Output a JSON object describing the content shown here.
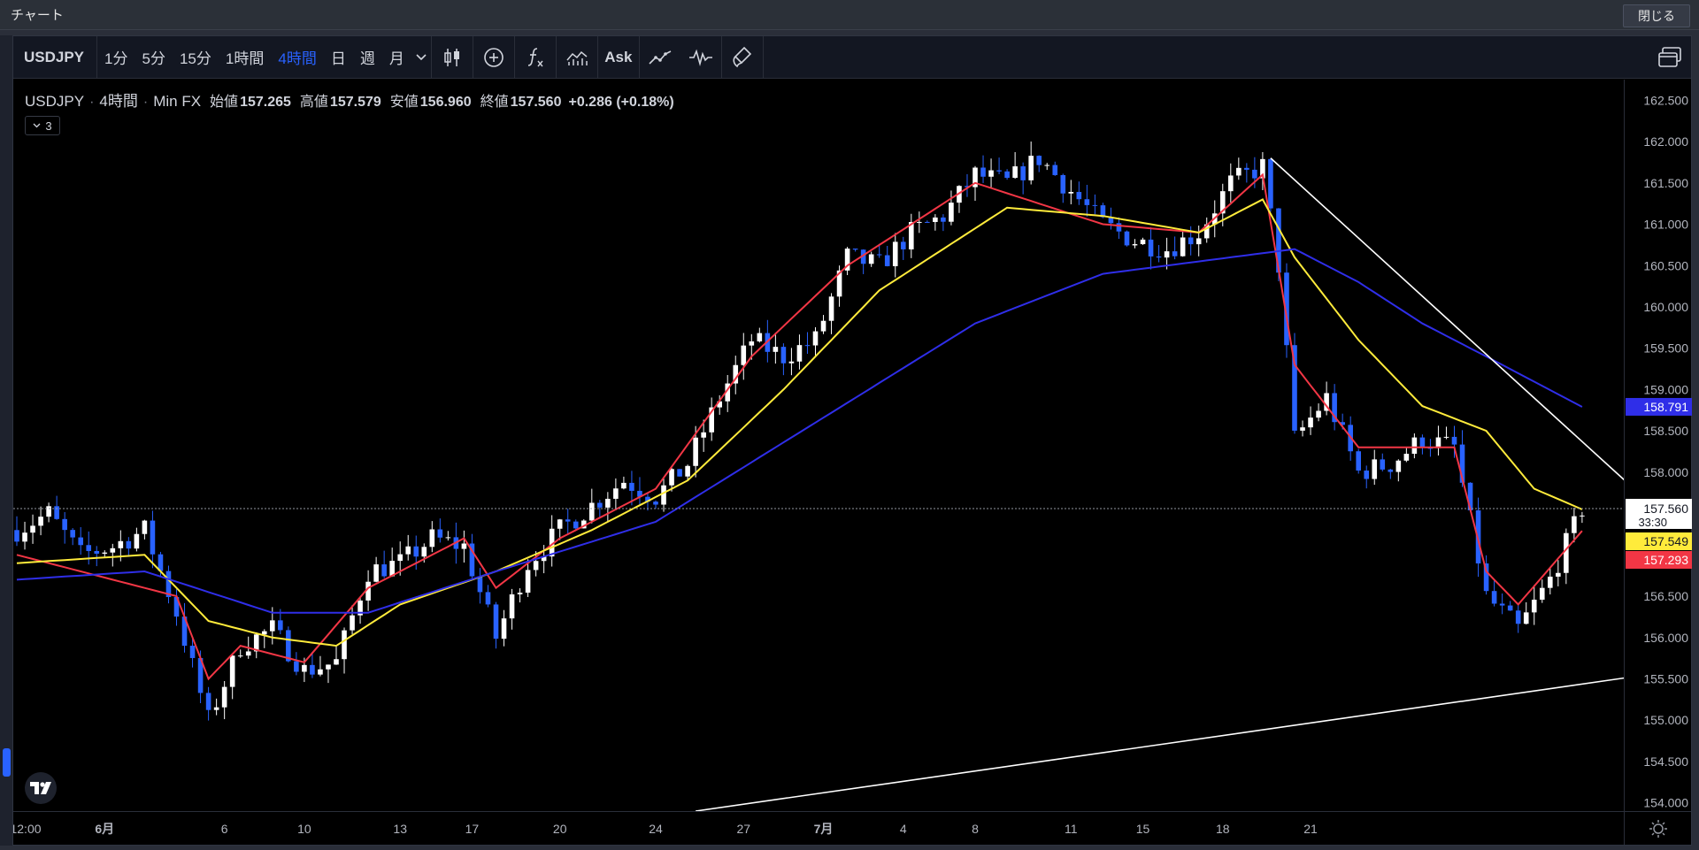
{
  "window": {
    "title": "チャート",
    "close_label": "閉じる"
  },
  "toolbar": {
    "symbol": "USDJPY",
    "intervals": [
      "1分",
      "5分",
      "15分",
      "1時間",
      "4時間",
      "日",
      "週",
      "月"
    ],
    "active_interval": "4時間",
    "ask_label": "Ask",
    "icons": [
      "chevron-down-icon",
      "candlestick-icon",
      "add-indicator-icon",
      "function-icon",
      "bar-compare-icon",
      "line-chart-icon",
      "waveform-icon",
      "brush-icon",
      "layout-icon"
    ]
  },
  "legend": {
    "symbol": "USDJPY",
    "interval": "4時間",
    "source": "Min FX",
    "open_label": "始値",
    "open": "157.265",
    "high_label": "高値",
    "high": "157.579",
    "low_label": "安値",
    "low": "156.960",
    "close_label": "終値",
    "close": "157.560",
    "change": "+0.286 (+0.18%)",
    "indicator_count": "3"
  },
  "price_axis": {
    "ticks": [
      "162.500",
      "162.000",
      "161.500",
      "161.000",
      "160.500",
      "160.000",
      "159.500",
      "159.000",
      "158.500",
      "158.000",
      "157.500",
      "157.000",
      "156.500",
      "156.000",
      "155.500",
      "155.000",
      "154.500",
      "154.000"
    ],
    "current_price": "157.560",
    "countdown": "33:30",
    "ma_labels": [
      {
        "value": "158.791",
        "color": "#2f2ee8"
      },
      {
        "value": "157.549",
        "color": "#ffeb3b"
      },
      {
        "value": "157.293",
        "color": "#f23645"
      }
    ]
  },
  "time_axis": {
    "labels": [
      "12:00",
      "6月",
      "6",
      "10",
      "13",
      "17",
      "20",
      "24",
      "27",
      "7月",
      "4",
      "8",
      "11",
      "15",
      "18",
      "21"
    ]
  },
  "colors": {
    "up": "#ffffff",
    "down": "#2962ff",
    "ma_fast": "#f23645",
    "ma_mid": "#ffeb3b",
    "ma_slow": "#2f2ee8",
    "trendline": "#ffffff"
  },
  "chart_data": {
    "type": "candlestick",
    "symbol": "USDJPY",
    "timeframe": "4時間",
    "ylim": [
      153.9,
      162.75
    ],
    "x_labels": [
      "12:00",
      "6月",
      "6",
      "10",
      "13",
      "17",
      "20",
      "24",
      "27",
      "7月",
      "4",
      "8",
      "11",
      "15",
      "18",
      "21"
    ],
    "close_path": [
      [
        0,
        157.3
      ],
      [
        4,
        157.5
      ],
      [
        8,
        157.0
      ],
      [
        12,
        157.1
      ],
      [
        16,
        157.3
      ],
      [
        20,
        156.3
      ],
      [
        24,
        155.0
      ],
      [
        28,
        155.9
      ],
      [
        32,
        156.1
      ],
      [
        36,
        155.6
      ],
      [
        40,
        155.7
      ],
      [
        44,
        156.8
      ],
      [
        48,
        156.9
      ],
      [
        52,
        157.2
      ],
      [
        56,
        157.1
      ],
      [
        60,
        156.0
      ],
      [
        64,
        156.9
      ],
      [
        68,
        157.3
      ],
      [
        72,
        157.6
      ],
      [
        76,
        157.9
      ],
      [
        80,
        157.7
      ],
      [
        84,
        158.1
      ],
      [
        88,
        158.9
      ],
      [
        92,
        159.6
      ],
      [
        96,
        159.4
      ],
      [
        100,
        159.6
      ],
      [
        104,
        160.6
      ],
      [
        108,
        160.5
      ],
      [
        112,
        160.9
      ],
      [
        116,
        161.1
      ],
      [
        120,
        161.6
      ],
      [
        124,
        161.5
      ],
      [
        128,
        161.8
      ],
      [
        132,
        161.4
      ],
      [
        136,
        161.0
      ],
      [
        140,
        160.8
      ],
      [
        144,
        160.7
      ],
      [
        148,
        160.9
      ],
      [
        152,
        161.5
      ],
      [
        156,
        161.7
      ],
      [
        158,
        160.5
      ],
      [
        160,
        158.4
      ],
      [
        164,
        158.9
      ],
      [
        168,
        158.0
      ],
      [
        172,
        158.1
      ],
      [
        176,
        158.4
      ],
      [
        180,
        158.3
      ],
      [
        184,
        156.5
      ],
      [
        188,
        156.1
      ],
      [
        192,
        156.7
      ],
      [
        196,
        157.56
      ]
    ],
    "series": [
      {
        "name": "",
        "color": "#f23645",
        "path": [
          [
            0,
            157.0
          ],
          [
            20,
            156.5
          ],
          [
            24,
            155.5
          ],
          [
            28,
            155.9
          ],
          [
            36,
            155.7
          ],
          [
            44,
            156.6
          ],
          [
            56,
            157.2
          ],
          [
            60,
            156.6
          ],
          [
            68,
            157.2
          ],
          [
            80,
            157.8
          ],
          [
            92,
            159.4
          ],
          [
            104,
            160.5
          ],
          [
            120,
            161.5
          ],
          [
            136,
            161.0
          ],
          [
            148,
            160.9
          ],
          [
            156,
            161.6
          ],
          [
            160,
            159.3
          ],
          [
            168,
            158.3
          ],
          [
            176,
            158.3
          ],
          [
            180,
            158.3
          ],
          [
            184,
            156.8
          ],
          [
            188,
            156.4
          ],
          [
            196,
            157.29
          ]
        ]
      },
      {
        "name": "",
        "color": "#ffeb3b",
        "path": [
          [
            0,
            156.9
          ],
          [
            16,
            157.0
          ],
          [
            24,
            156.2
          ],
          [
            32,
            156.0
          ],
          [
            40,
            155.9
          ],
          [
            48,
            156.4
          ],
          [
            60,
            156.8
          ],
          [
            72,
            157.3
          ],
          [
            84,
            157.9
          ],
          [
            96,
            159.0
          ],
          [
            108,
            160.2
          ],
          [
            124,
            161.2
          ],
          [
            136,
            161.1
          ],
          [
            148,
            160.9
          ],
          [
            156,
            161.3
          ],
          [
            160,
            160.6
          ],
          [
            168,
            159.6
          ],
          [
            176,
            158.8
          ],
          [
            184,
            158.5
          ],
          [
            190,
            157.8
          ],
          [
            196,
            157.55
          ]
        ]
      },
      {
        "name": "",
        "color": "#2f2ee8",
        "path": [
          [
            0,
            156.7
          ],
          [
            16,
            156.8
          ],
          [
            32,
            156.3
          ],
          [
            44,
            156.3
          ],
          [
            60,
            156.8
          ],
          [
            80,
            157.4
          ],
          [
            100,
            158.6
          ],
          [
            120,
            159.8
          ],
          [
            136,
            160.4
          ],
          [
            152,
            160.6
          ],
          [
            160,
            160.7
          ],
          [
            168,
            160.3
          ],
          [
            176,
            159.8
          ],
          [
            184,
            159.4
          ],
          [
            196,
            158.79
          ]
        ]
      }
    ],
    "trendlines": [
      {
        "from": [
          157,
          161.8
        ],
        "to": [
          215,
          156.7
        ]
      },
      {
        "from": [
          85,
          153.9
        ],
        "to": [
          215,
          155.7
        ]
      }
    ]
  }
}
